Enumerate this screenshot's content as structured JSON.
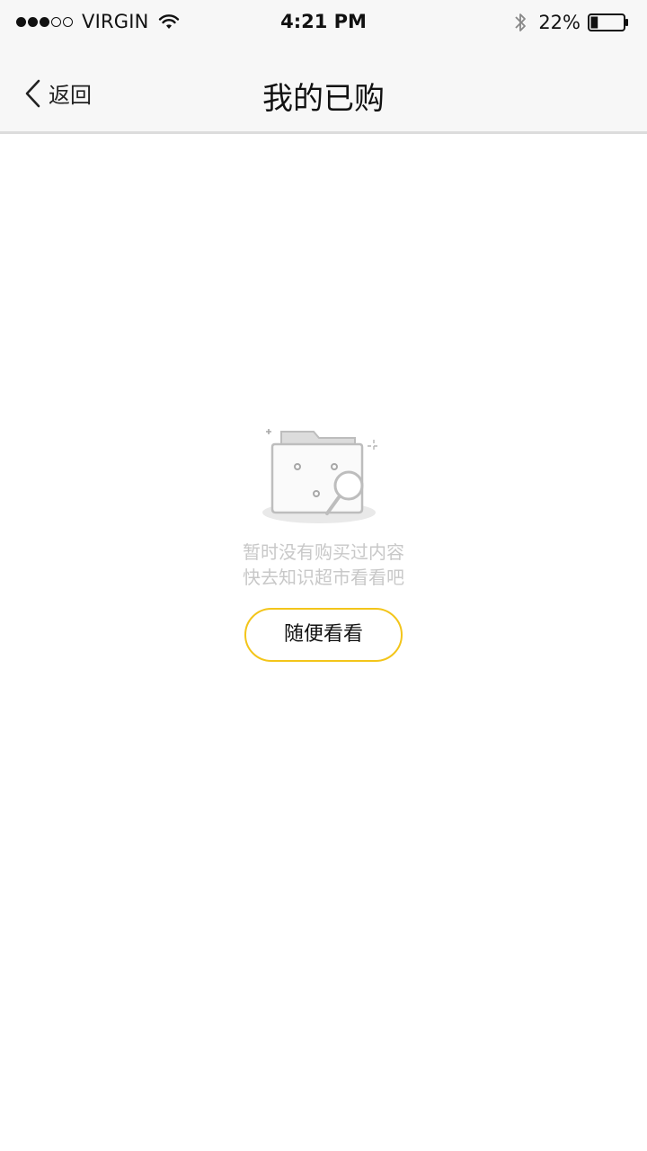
{
  "status_bar": {
    "carrier": "VIRGIN",
    "time": "4:21 PM",
    "battery_percent": "22%",
    "battery_level": 0.22,
    "signal_bars_filled": 3,
    "signal_bars_total": 5
  },
  "nav": {
    "back_label": "返回",
    "title": "我的已购"
  },
  "empty_state": {
    "icon": "empty-folder-search-icon",
    "line1": "暂时没有购买过内容",
    "line2": "快去知识超市看看吧",
    "button_label": "随便看看"
  },
  "colors": {
    "accent": "#f3c51a",
    "hint_text": "#c8c8c8",
    "bar_background": "#f7f7f7"
  }
}
